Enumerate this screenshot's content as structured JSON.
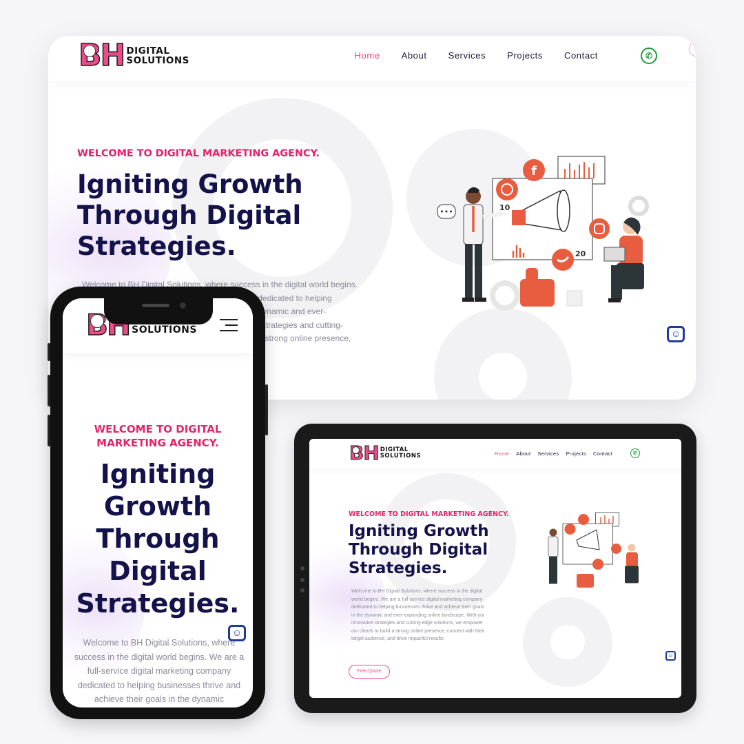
{
  "brand": {
    "mark": "BH",
    "name_line1": "DIGITAL",
    "name_line2": "SOLUTIONS"
  },
  "nav": {
    "items": [
      "Home",
      "About",
      "Services",
      "Projects",
      "Contact"
    ],
    "active": "Home"
  },
  "hero": {
    "eyebrow": "WELCOME TO DIGITAL MARKETING AGENCY.",
    "eyebrow_mobile_line1": "WELCOME TO DIGITAL",
    "eyebrow_mobile_line2": "MARKETING AGENCY.",
    "headline_desktop": [
      "Igniting Growth",
      "Through Digital",
      "Strategies."
    ],
    "headline_mobile": [
      "Igniting",
      "Growth",
      "Through",
      "Digital",
      "Strategies."
    ],
    "paragraph": "Welcome to BH Digital Solutions, where success in the digital world begins. We are a full-service digital marketing company dedicated to helping businesses thrive and achieve their goals in the dynamic and ever-expanding online landscape. With our innovative strategies and cutting-edge solutions, we empower our clients to build a strong online presence, connect with their target audience, and drive impactful results.",
    "paragraph_desktop_visible": "Welcome to BH Digital Solutions, where success in the digital world begins. We are a full-service digital marketing company dedicated to helping businesses thrive and achieve their goals in the dynamic and ever-expanding online landscape. With our innovative strategies and cutting-edge solutions, we empower our clients to build a strong online presence, connect with their target audience, and drive",
    "paragraph_mobile_visible": "Welcome to BH Digital Solutions, where success in the digital world begins. We are a full-service digital marketing company dedicated to helping businesses thrive and achieve their goals in the dynamic",
    "cta_label": "Free Quote"
  },
  "illustration": {
    "counts": [
      "10",
      "20"
    ],
    "icons": [
      "whatsapp-icon",
      "facebook-icon",
      "instagram-icon",
      "twitter-icon",
      "megaphone-icon",
      "thumbs-up-icon",
      "bar-chart-icon"
    ]
  },
  "colors": {
    "accent": "#ea4c89",
    "eyebrow": "#e3246b",
    "heading": "#14124a",
    "whatsapp": "#1c9d3b",
    "chat": "#1e3a9a"
  }
}
